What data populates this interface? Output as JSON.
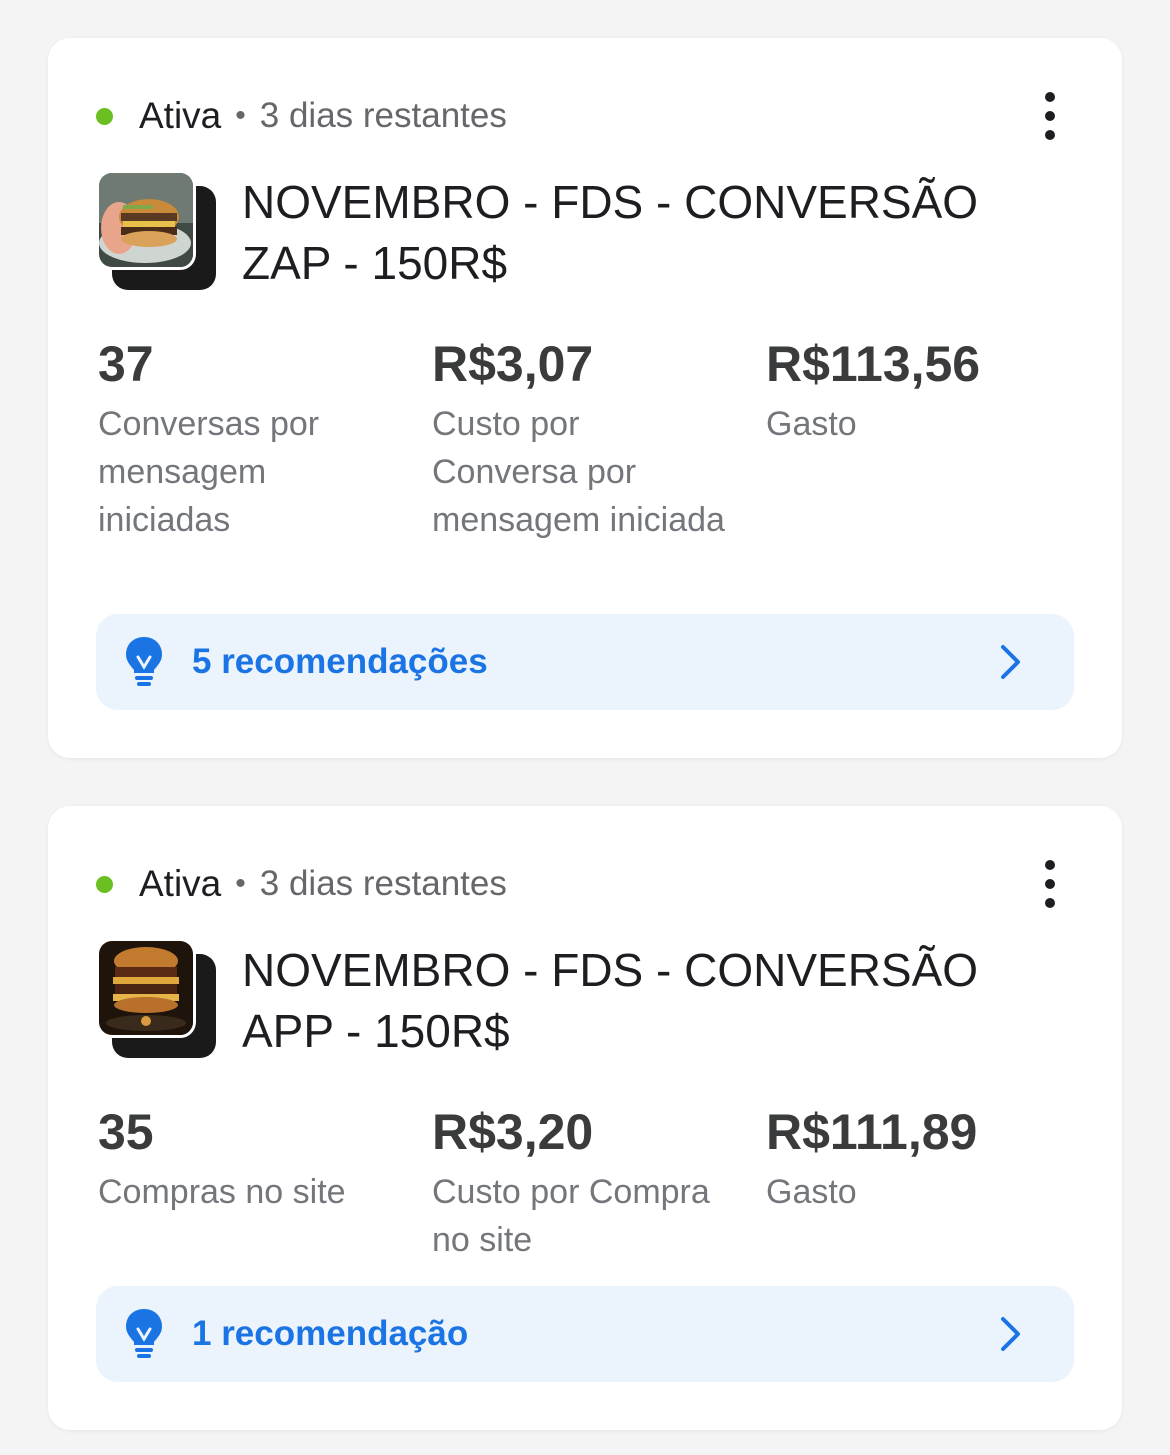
{
  "campaigns": [
    {
      "status": "Ativa",
      "separator": "•",
      "remaining": "3 dias restantes",
      "title": "NOVEMBRO - FDS - CONVERSÃO ZAP - 150R$",
      "metrics": [
        {
          "value": "37",
          "label": "Conversas por mensagem iniciadas"
        },
        {
          "value": "R$3,07",
          "label": "Custo por Conversa por mensagem iniciada"
        },
        {
          "value": "R$113,56",
          "label": "Gasto"
        }
      ],
      "recommendations": "5 recomendações"
    },
    {
      "status": "Ativa",
      "separator": "•",
      "remaining": "3 dias restantes",
      "title": "NOVEMBRO - FDS - CONVERSÃO APP - 150R$",
      "metrics": [
        {
          "value": "35",
          "label": "Compras no site"
        },
        {
          "value": "R$3,20",
          "label": "Custo por Compra no site"
        },
        {
          "value": "R$111,89",
          "label": "Gasto"
        }
      ],
      "recommendations": "1 recomendação"
    }
  ],
  "colors": {
    "status_active": "#6bbf20",
    "accent": "#1b74e4",
    "rec_background": "#ebf3fd"
  },
  "icons": {
    "status": "status-dot-icon",
    "more": "more-vertical-icon",
    "recommendation": "lightbulb-icon",
    "chevron": "chevron-right-icon"
  }
}
